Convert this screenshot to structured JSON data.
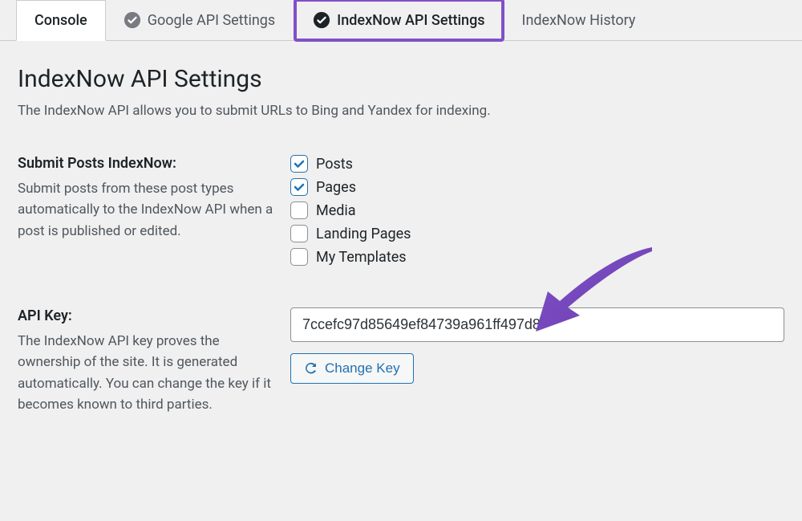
{
  "tabs": [
    {
      "label": "Console",
      "has_check": false,
      "active": true
    },
    {
      "label": "Google API Settings",
      "has_check": true,
      "active": false
    },
    {
      "label": "IndexNow API Settings",
      "has_check": true,
      "active": false,
      "highlighted": true
    },
    {
      "label": "IndexNow History",
      "has_check": false,
      "active": false
    }
  ],
  "page_title": "IndexNow API Settings",
  "page_description": "The IndexNow API allows you to submit URLs to Bing and Yandex for indexing.",
  "submit_posts": {
    "label": "Submit Posts IndexNow:",
    "help": "Submit posts from these post types automatically to the IndexNow API when a post is published or edited.",
    "options": [
      {
        "label": "Posts",
        "checked": true
      },
      {
        "label": "Pages",
        "checked": true
      },
      {
        "label": "Media",
        "checked": false
      },
      {
        "label": "Landing Pages",
        "checked": false
      },
      {
        "label": "My Templates",
        "checked": false
      }
    ]
  },
  "api_key": {
    "label": "API Key:",
    "help": "The IndexNow API key proves the ownership of the site. It is generated automatically. You can change the key if it becomes known to third parties.",
    "value": "7ccefc97d85649ef84739a961ff497d8",
    "change_button": "Change Key"
  }
}
